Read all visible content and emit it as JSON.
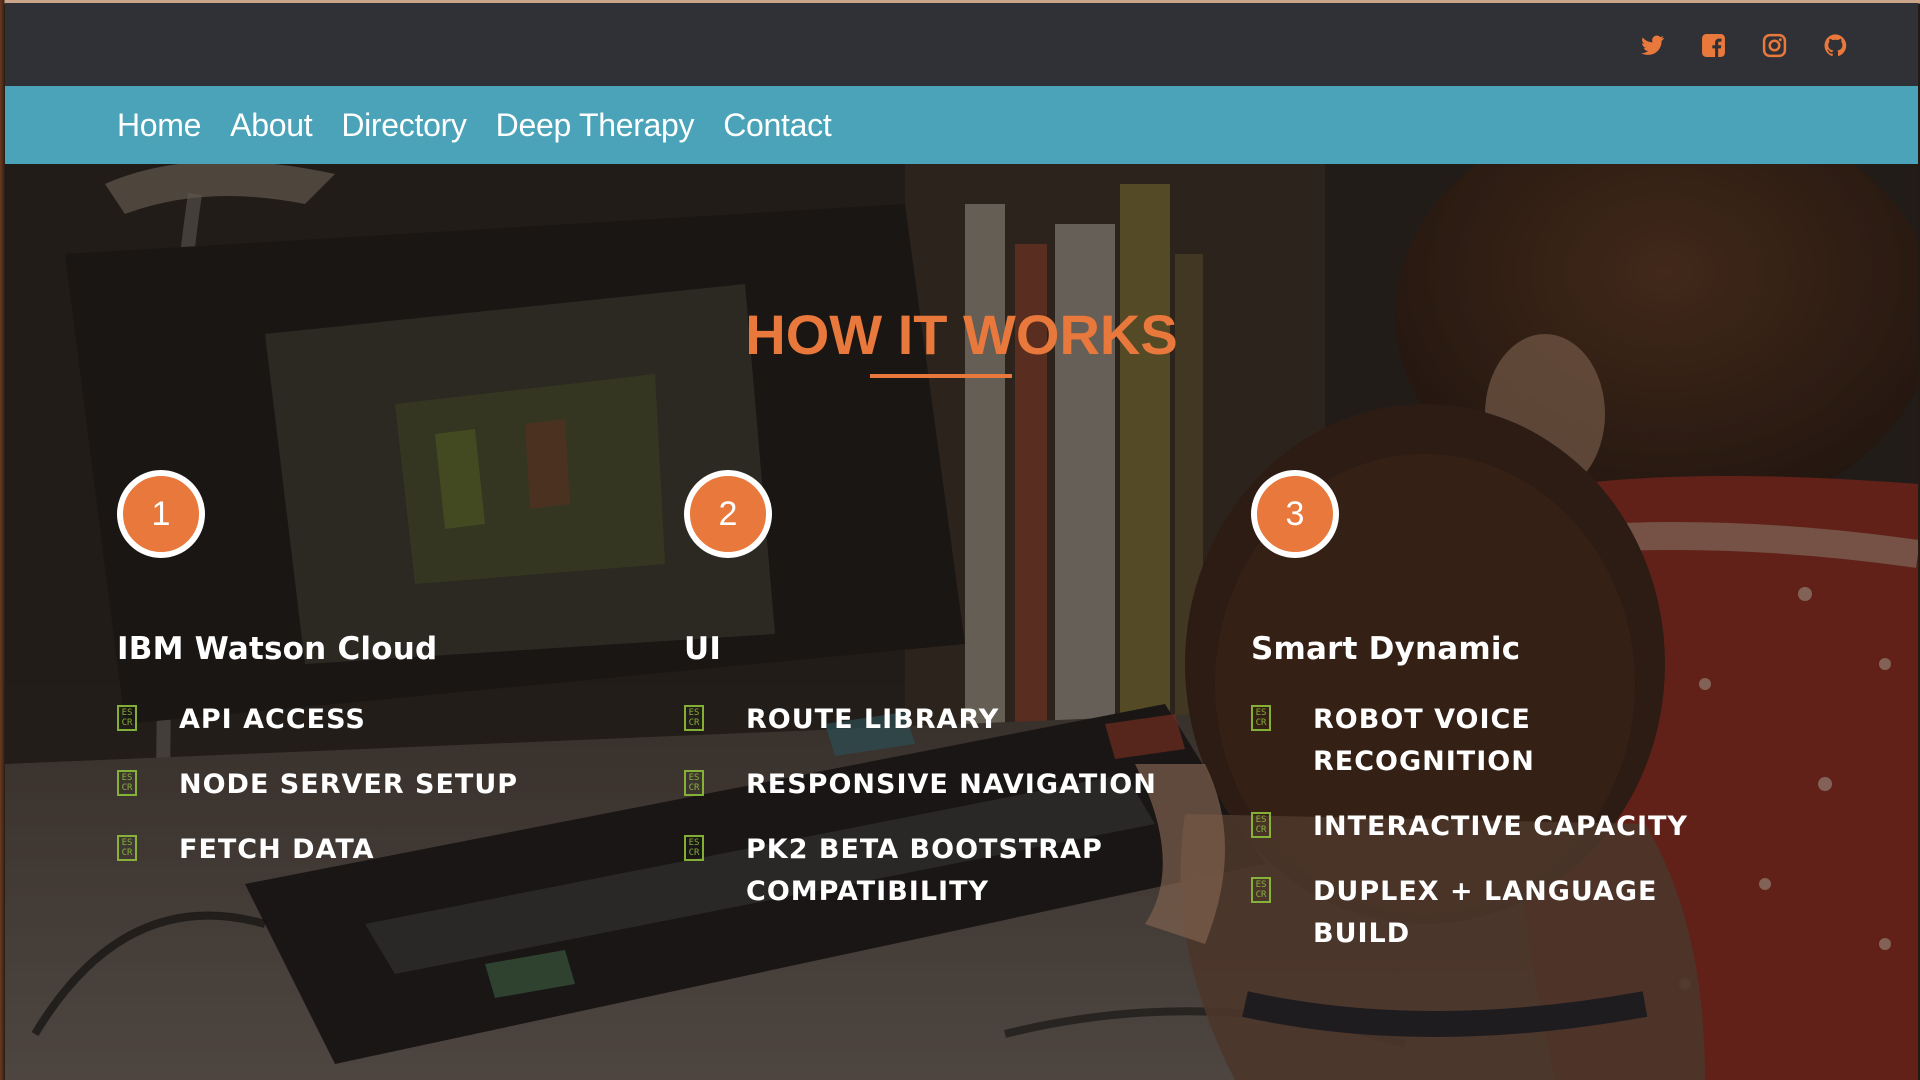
{
  "social": {
    "icons": [
      "twitter-icon",
      "facebook-icon",
      "instagram-icon",
      "github-icon"
    ],
    "accent": "#e8783b"
  },
  "nav": {
    "items": [
      "Home",
      "About",
      "Directory",
      "Deep Therapy",
      "Contact"
    ]
  },
  "section": {
    "title": "HOW IT WORKS",
    "columns": [
      {
        "step": "1",
        "title": "IBM Watson Cloud",
        "items": [
          "API ACCESS",
          "NODE SERVER SETUP",
          "FETCH DATA"
        ]
      },
      {
        "step": "2",
        "title": "UI",
        "items": [
          "ROUTE LIBRARY",
          "RESPONSIVE NAVIGATION",
          "PK2 BETA BOOTSTRAP COMPATIBILITY"
        ]
      },
      {
        "step": "3",
        "title": "Smart Dynamic",
        "items": [
          "ROBOT VOICE RECOGNITION",
          "INTERACTIVE CAPACITY",
          "DUPLEX + LANGUAGE BUILD"
        ]
      }
    ],
    "bullet_glyph": "ES CR"
  },
  "colors": {
    "topbar": "#2f3137",
    "navbar": "#4aa3b8",
    "accent": "#e8783b",
    "bullet": "#8fbf3a"
  }
}
